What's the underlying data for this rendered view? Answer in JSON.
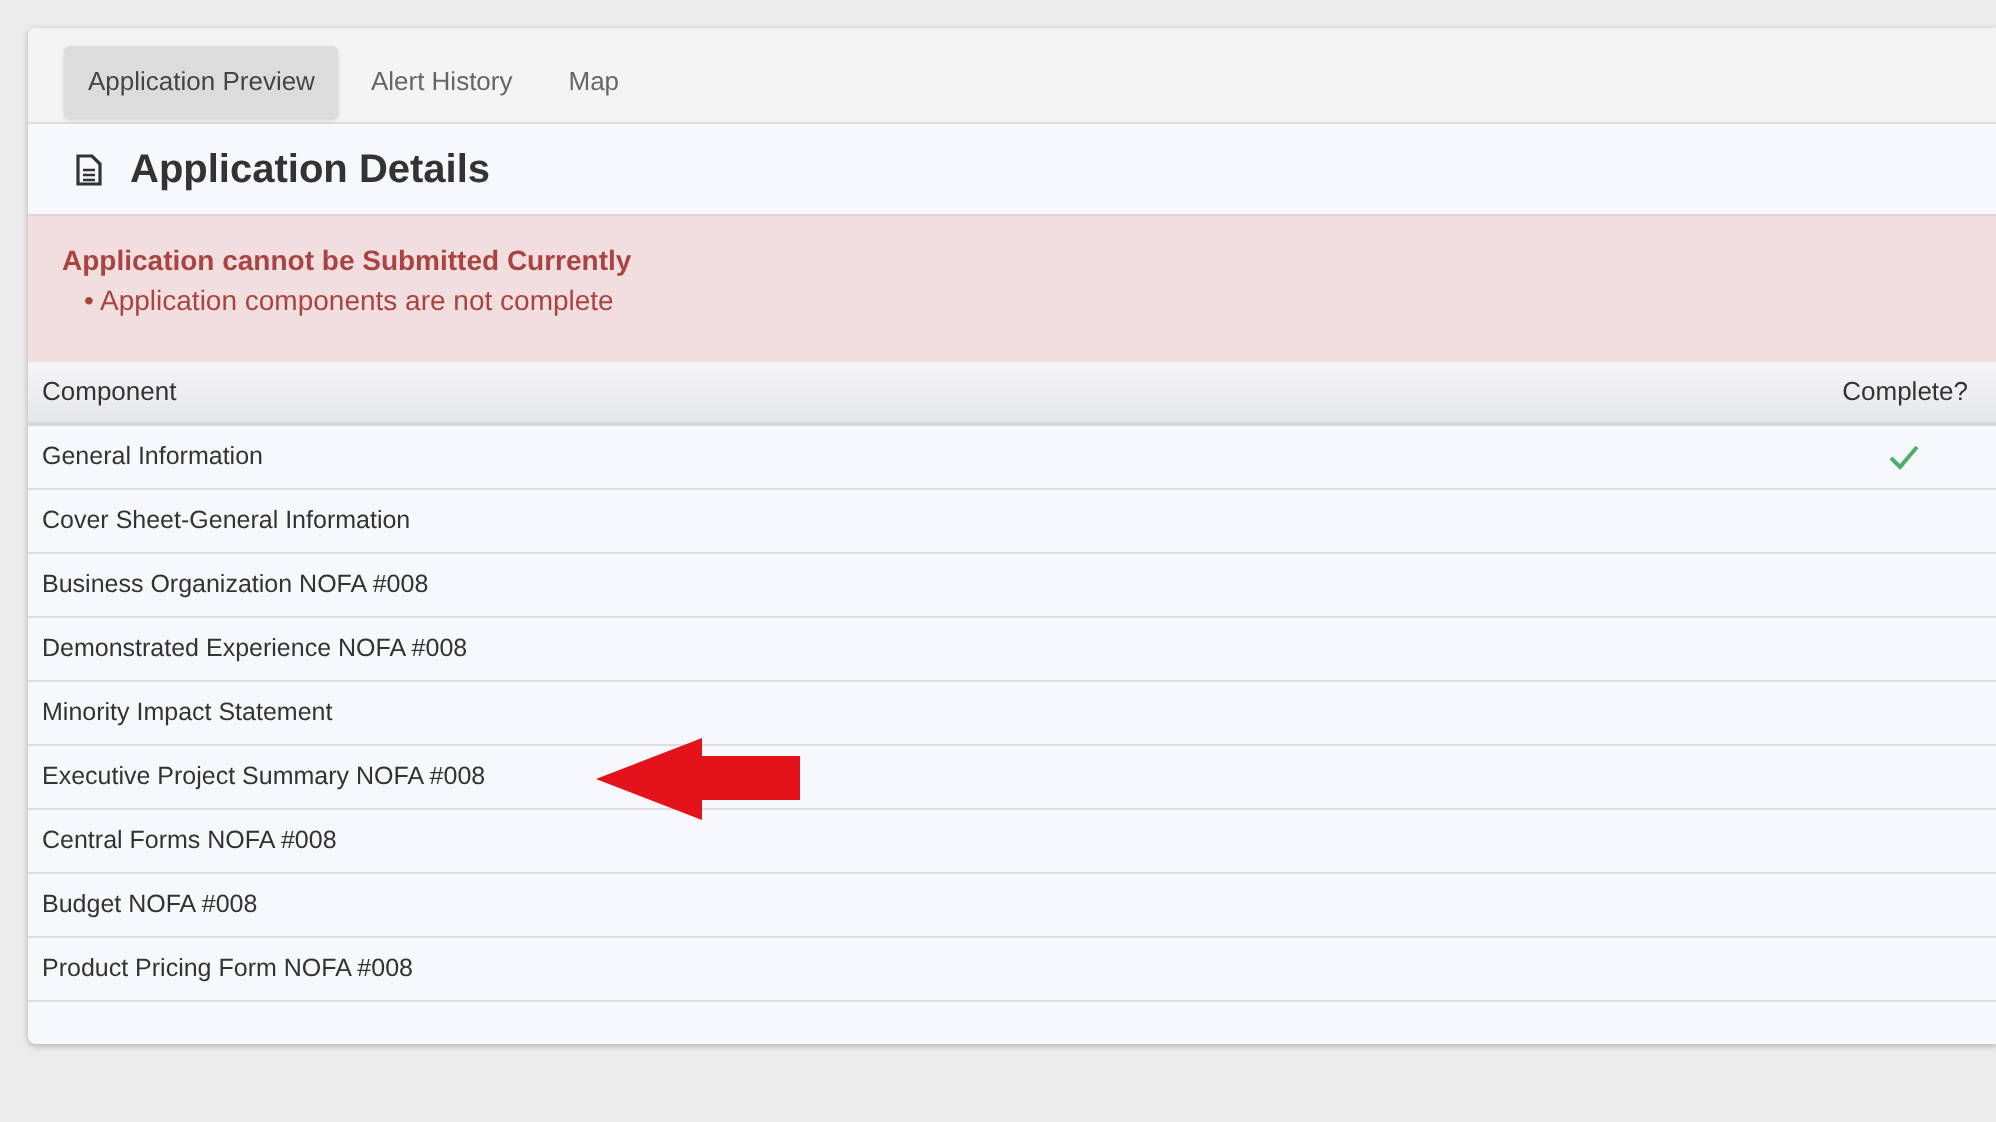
{
  "tabs": [
    {
      "label": "Application Preview",
      "selected": true
    },
    {
      "label": "Alert History",
      "selected": false
    },
    {
      "label": "Map",
      "selected": false
    }
  ],
  "panel": {
    "title": "Application Details"
  },
  "alert": {
    "title": "Application cannot be Submitted Currently",
    "items": [
      "• Application components are not complete"
    ]
  },
  "table": {
    "columns": [
      "Component",
      "Complete?"
    ],
    "rows": [
      {
        "component": "General Information",
        "complete": true,
        "arrow": false
      },
      {
        "component": "Cover Sheet-General Information",
        "complete": false,
        "arrow": false
      },
      {
        "component": "Business Organization NOFA #008",
        "complete": false,
        "arrow": false
      },
      {
        "component": "Demonstrated Experience NOFA #008",
        "complete": false,
        "arrow": false
      },
      {
        "component": "Minority Impact Statement",
        "complete": false,
        "arrow": false
      },
      {
        "component": "Executive Project Summary NOFA #008",
        "complete": false,
        "arrow": true
      },
      {
        "component": "Central Forms NOFA #008",
        "complete": false,
        "arrow": false
      },
      {
        "component": "Budget NOFA #008",
        "complete": false,
        "arrow": false
      },
      {
        "component": "Product Pricing Form NOFA #008",
        "complete": false,
        "arrow": false
      }
    ]
  }
}
